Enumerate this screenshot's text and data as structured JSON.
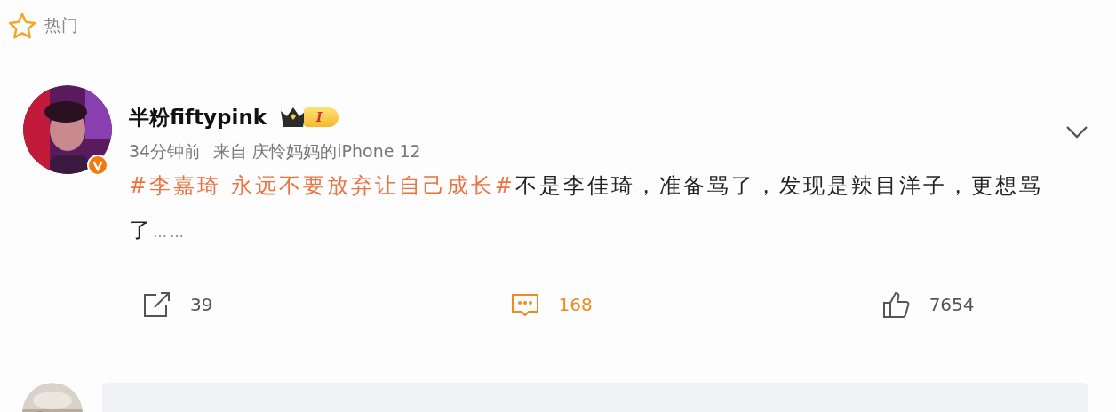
{
  "section": {
    "title": "热门"
  },
  "post": {
    "author": "半粉fiftypink",
    "level_badge": "I",
    "verified": true,
    "time": "34分钟前",
    "source": "来自 庆怜妈妈的iPhone 12",
    "body": [
      {
        "kind": "topic",
        "text": "#李嘉琦 永远不要放弃让自己成长#"
      },
      {
        "kind": "plain",
        "text": "不是李佳琦，准备骂了，发现是辣目洋子，更想骂了"
      },
      {
        "kind": "ellipsis",
        "text": "……"
      }
    ],
    "actions": [
      {
        "kind": "share",
        "count": "39",
        "selected": false
      },
      {
        "kind": "comment",
        "count": "168",
        "selected": true
      },
      {
        "kind": "like",
        "count": "7654",
        "selected": false
      }
    ]
  }
}
